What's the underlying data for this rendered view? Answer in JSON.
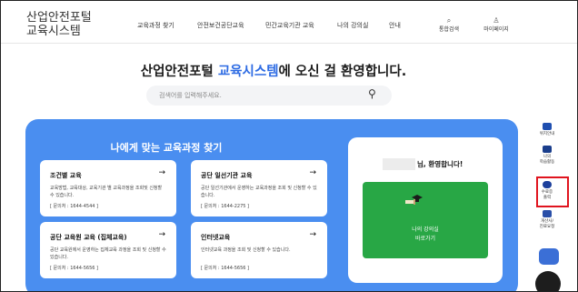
{
  "header": {
    "logo_line1": "산업안전포털",
    "logo_line2": "교육시스템",
    "nav": [
      "교육과정 찾기",
      "안전보건공단교육",
      "민간교육기관 교육",
      "나의 강의실",
      "안내"
    ],
    "util": [
      {
        "icon": "search-icon",
        "glyph": "⌕",
        "label": "통합검색"
      },
      {
        "icon": "user-icon",
        "glyph": "♙",
        "label": "마이페이지"
      }
    ]
  },
  "hero": {
    "title_prefix": "산업안전포털 ",
    "title_accent": "교육시스템",
    "title_suffix": "에 오신 걸 환영합니다.",
    "search_placeholder": "검색어를 입력해주세요."
  },
  "panel": {
    "title": "나에게 맞는 교육과정 찾기",
    "cards": [
      {
        "title": "조건별 교육",
        "arrow": "→",
        "desc": "교육방법, 교육대상, 교육기관 별 교육과정을 조회및 신청할 수 있습니다.",
        "contact": "[ 문의처 : 1644-4544 ]"
      },
      {
        "title": "공단 일선기관 교육",
        "arrow": "→",
        "desc": "공단 일선기관에서 운영하는 교육과정을 조회 및 신청할 수 있습니다.",
        "contact": "[ 문의처 : 1644-2275 ]"
      },
      {
        "title": "공단 교육원 교육 (집체교육)",
        "arrow": "→",
        "desc": "공단 교육원에서 운영하는 집체교육 과정을 조회 및 신청할 수 있습니다.",
        "contact": "[ 문의처 : 1644-5656 ]"
      },
      {
        "title": "인터넷교육",
        "arrow": "→",
        "desc": "인터넷교육 과정을 조회 및 신청할 수 있습니다.",
        "contact": "[ 문의처 : 1644-5656 ]"
      }
    ],
    "welcome": {
      "greeting": "님, 환영합니다!",
      "my_classroom_line1": "나의 강의실",
      "my_classroom_line2": "바로가기"
    }
  },
  "quick_menu": [
    {
      "label1": "위치안내",
      "label2": ""
    },
    {
      "label1": "나의",
      "label2": "학습활동"
    },
    {
      "label1": "수료증",
      "label2": "출력"
    },
    {
      "label1": "개산사/",
      "label2": "진료요청"
    }
  ],
  "colors": {
    "accent": "#2d6be3",
    "panel": "#4a8ef0",
    "green": "#28a745",
    "highlight": "#e0141e"
  }
}
